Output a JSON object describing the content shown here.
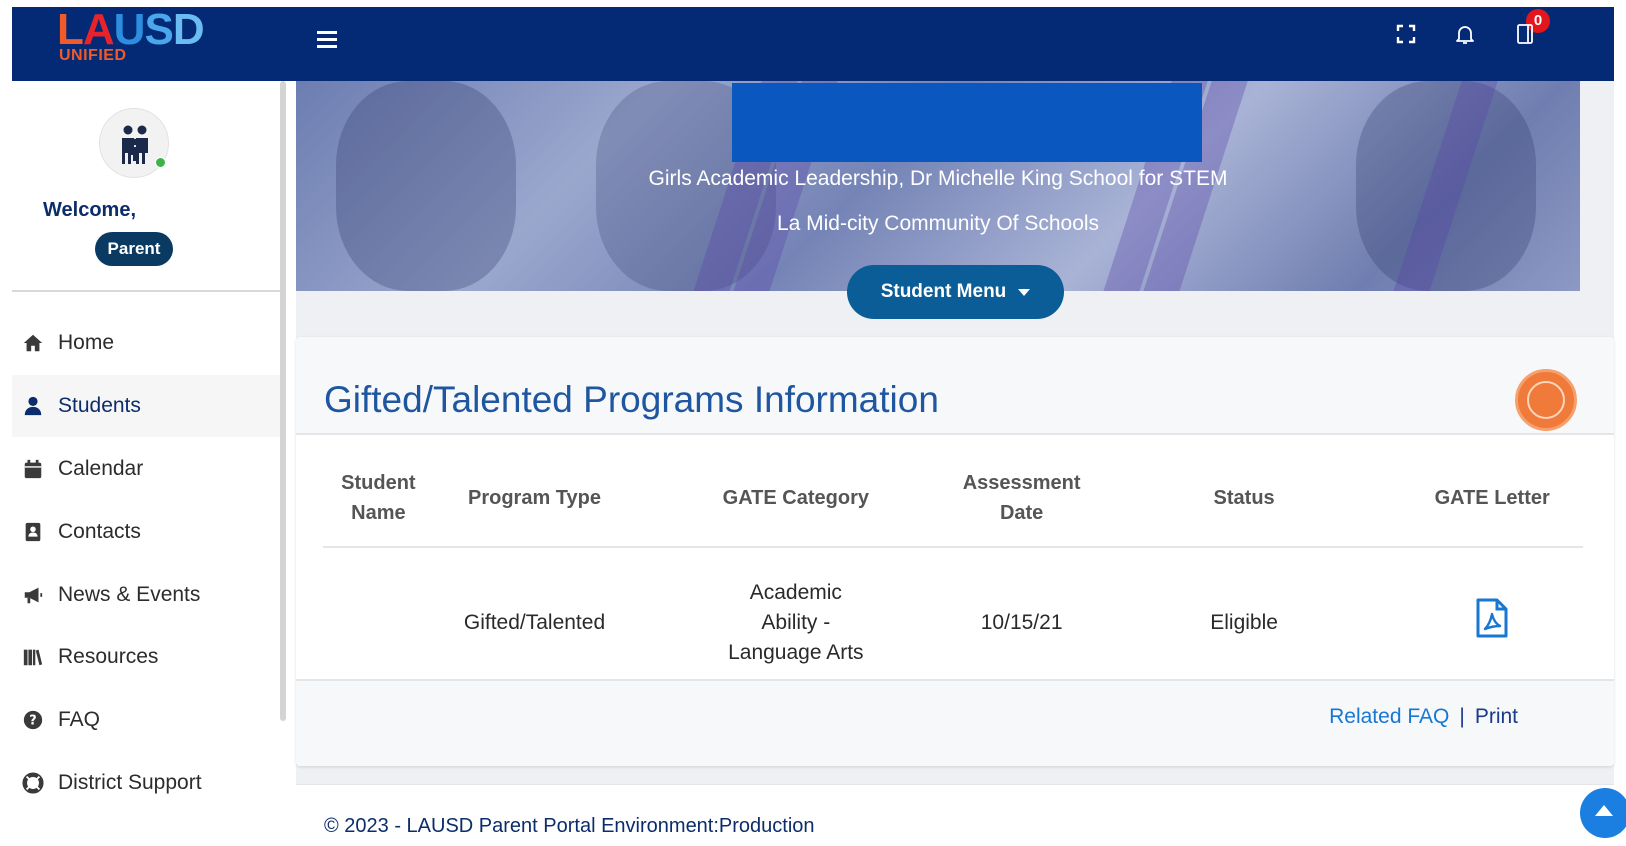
{
  "header": {
    "logo_text": "LAUSD",
    "logo_subtext": "UNIFIED",
    "notifications_count": "0",
    "icons": [
      "menu-icon",
      "fullscreen-icon",
      "bell-icon",
      "notebook-icon"
    ]
  },
  "sidebar": {
    "welcome": "Welcome,",
    "role": "Parent",
    "items": [
      {
        "label": "Home",
        "icon": "home-icon"
      },
      {
        "label": "Students",
        "icon": "user-icon"
      },
      {
        "label": "Calendar",
        "icon": "calendar-icon"
      },
      {
        "label": "Contacts",
        "icon": "contacts-icon"
      },
      {
        "label": "News & Events",
        "icon": "megaphone-icon"
      },
      {
        "label": "Resources",
        "icon": "books-icon"
      },
      {
        "label": "FAQ",
        "icon": "question-icon"
      },
      {
        "label": "District Support",
        "icon": "lifebuoy-icon"
      }
    ],
    "active_item": "Students"
  },
  "hero": {
    "school_name": "Girls Academic Leadership, Dr Michelle King School for STEM",
    "district_name": "La Mid-city Community Of Schools",
    "student_menu_label": "Student Menu"
  },
  "card": {
    "title": "Gifted/Talented Programs Information",
    "columns": [
      "Student Name",
      "Program Type",
      "GATE Category",
      "Assessment Date",
      "Status",
      "GATE Letter"
    ],
    "rows": [
      {
        "student_name": "",
        "program_type": "Gifted/Talented",
        "gate_category": "Academic Ability - Language Arts",
        "assessment_date": "10/15/21",
        "status": "Eligible",
        "gate_letter_icon": "pdf-icon"
      }
    ],
    "footer_links": {
      "related_faq": "Related FAQ",
      "separator": "|",
      "print": "Print"
    }
  },
  "footer": {
    "copyright": "© 2023 - LAUSD Parent Portal Environment:Production"
  },
  "colors": {
    "topbar": "#042a75",
    "accent_blue": "#1f56a0",
    "link_blue": "#1877d2",
    "student_menu": "#0a5d96",
    "badge": "#e3161e"
  }
}
